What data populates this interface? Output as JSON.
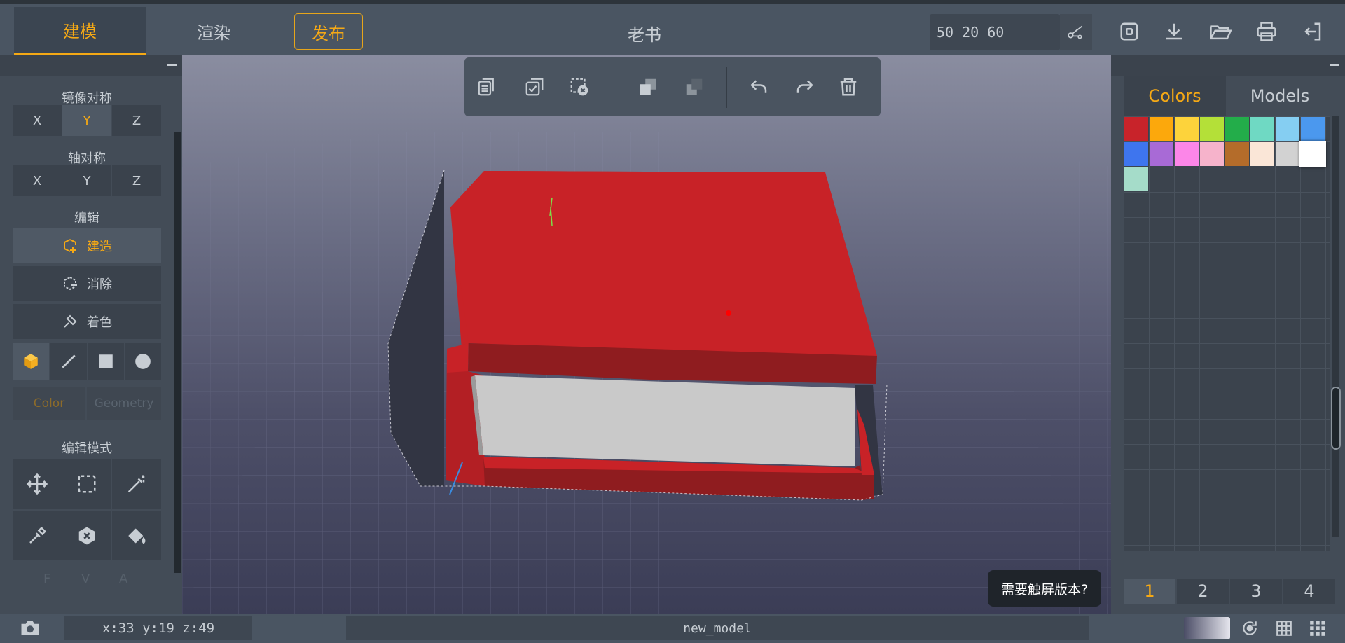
{
  "topbar": {
    "tabs": [
      "建模",
      "渲染"
    ],
    "publish_label": "发布",
    "title": "老书",
    "dims_value": "50 20 60",
    "icons": [
      "cut-icon",
      "save-icon",
      "download-icon",
      "open-folder-icon",
      "print-icon",
      "exit-icon"
    ]
  },
  "left_panel": {
    "mirror": {
      "label": "镜像对称",
      "axes": [
        "X",
        "Y",
        "Z"
      ],
      "active": "Y"
    },
    "axis": {
      "label": "轴对称",
      "axes": [
        "X",
        "Y",
        "Z"
      ]
    },
    "edit": {
      "label": "编辑",
      "actions": [
        "建造",
        "消除",
        "着色"
      ],
      "active": "建造"
    },
    "shapes": [
      "cube-icon",
      "line-icon",
      "square-icon",
      "circle-icon"
    ],
    "subtabs": [
      "Color",
      "Geometry"
    ],
    "mode": {
      "label": "编辑模式",
      "tools": [
        "move-icon",
        "box-select-icon",
        "magic-wand-icon",
        "eyedropper-icon",
        "remove-hex-icon",
        "paint-bucket-icon"
      ]
    },
    "fva": [
      "F",
      "V",
      "A"
    ]
  },
  "viewport": {
    "toolbar_icons": [
      "copy-icon",
      "paste-check-icon",
      "clear-selection-icon",
      "layer-front-icon",
      "layer-back-icon",
      "undo-icon",
      "redo-icon",
      "trash-icon"
    ],
    "touch_tip": "需要触屏版本?"
  },
  "right_panel": {
    "tabs": [
      "Colors",
      "Models"
    ],
    "colors": [
      "#c8232a",
      "#fca80c",
      "#fdd33b",
      "#b4e038",
      "#23ad4a",
      "#6fd9c3",
      "#85cef2",
      "#4b98ee",
      "#3e75ee",
      "#a86ad6",
      "#fc86e8",
      "#f6b3cb",
      "#b46c2a",
      "#fae6d7",
      "#d2d2d2",
      "#ffffff",
      "#a5dcc9"
    ],
    "selected_color": "#ffffff",
    "pages": [
      "1",
      "2",
      "3",
      "4"
    ],
    "active_page": "1"
  },
  "status": {
    "coords": "x:33 y:19 z:49",
    "model_name": "new_model"
  }
}
